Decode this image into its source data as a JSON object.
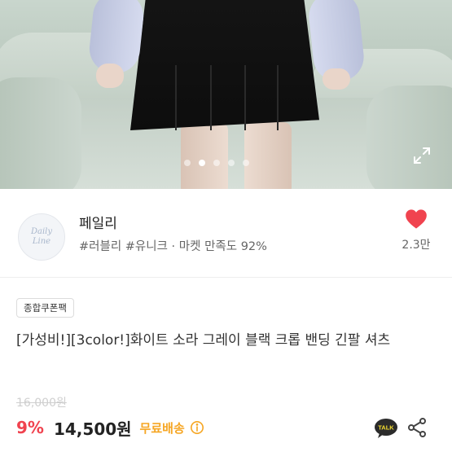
{
  "gallery": {
    "dots": [
      false,
      true,
      false,
      false,
      false
    ],
    "expand_icon": "expand-icon"
  },
  "seller": {
    "avatar_text": [
      "Daily",
      "Line"
    ],
    "name": "페일리",
    "tags": "#러블리 #유니크 · 마켓 만족도 92%",
    "like_count": "2.3만",
    "like_color": "#f0434f"
  },
  "product": {
    "badge": "종합쿠폰팩",
    "title": "[가성비!][3color!]화이트 소라 그레이 블랙 크롭 밴딩 긴팔 셔츠",
    "original_price": "16,000원",
    "discount": "9%",
    "price": "14,500원",
    "shipping": "무료배송"
  },
  "colors": {
    "accent_red": "#f0434f",
    "shipping_orange": "#f6a623",
    "talk_yellow": "#f7df2f"
  },
  "icons": [
    "heart-icon",
    "expand-icon",
    "info-icon",
    "talk-icon",
    "share-icon"
  ]
}
